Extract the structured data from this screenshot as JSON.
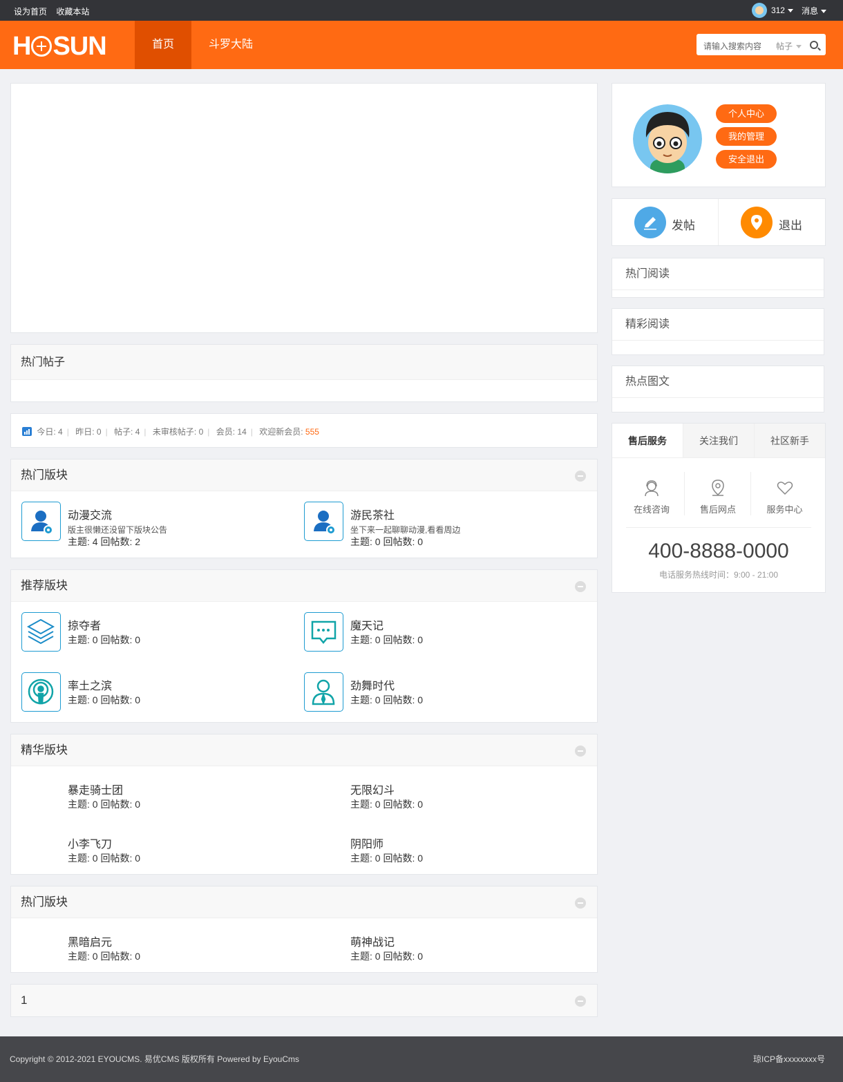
{
  "topbar": {
    "set_home": "设为首页",
    "bookmark": "收藏本站",
    "count": "312",
    "messages": "消息"
  },
  "header": {
    "logo_left": "H",
    "logo_right": "SUN",
    "nav": [
      "首页",
      "斗罗大陆"
    ],
    "search_placeholder": "请输入搜索内容",
    "search_type": "帖子"
  },
  "main": {
    "hot_posts_title": "热门帖子",
    "stats": {
      "today_label": "今日:",
      "today": "4",
      "yesterday_label": "昨日:",
      "yesterday": "0",
      "posts_label": "帖子:",
      "posts": "4",
      "unreviewed_label": "未审核帖子:",
      "unreviewed": "0",
      "members_label": "会员:",
      "members": "14",
      "welcome_label": "欢迎新会员:",
      "welcome": "555"
    },
    "sections": [
      {
        "title": "热门版块",
        "forums": [
          {
            "name": "动漫交流",
            "desc": "版主很懒还没留下版块公告",
            "stat": "主题: 4 回帖数: 2"
          },
          {
            "name": "游民茶社",
            "desc": "坐下来一起聊聊动漫,看看周边",
            "stat": "主题: 0 回帖数: 0"
          }
        ]
      },
      {
        "title": "推荐版块",
        "forums": [
          {
            "name": "掠夺者",
            "stat": "主题: 0 回帖数: 0"
          },
          {
            "name": "魔天记",
            "stat": "主题: 0 回帖数: 0"
          },
          {
            "name": "率土之滨",
            "stat": "主题: 0 回帖数: 0"
          },
          {
            "name": "劲舞时代",
            "stat": "主题: 0 回帖数: 0"
          }
        ]
      },
      {
        "title": "精华版块",
        "forums": [
          {
            "name": "暴走骑士团",
            "stat": "主题: 0 回帖数: 0"
          },
          {
            "name": "无限幻斗",
            "stat": "主题: 0 回帖数: 0"
          },
          {
            "name": "小李飞刀",
            "stat": "主题: 0 回帖数: 0"
          },
          {
            "name": "阴阳师",
            "stat": "主题: 0 回帖数: 0"
          }
        ]
      },
      {
        "title": "热门版块",
        "forums": [
          {
            "name": "黑暗启元",
            "stat": "主题: 0 回帖数: 0"
          },
          {
            "name": "萌神战记",
            "stat": "主题: 0 回帖数: 0"
          }
        ]
      },
      {
        "title": "1",
        "forums": []
      }
    ]
  },
  "sidebar": {
    "user_buttons": [
      "个人中心",
      "我的管理",
      "安全退出"
    ],
    "actions": [
      "发帖",
      "退出"
    ],
    "lists": [
      "热门阅读",
      "精彩阅读",
      "热点图文"
    ],
    "tabs": [
      "售后服务",
      "关注我们",
      "社区新手"
    ],
    "services": [
      "在线咨询",
      "售后网点",
      "服务中心"
    ],
    "phone": "400-8888-0000",
    "hours": "电话服务热线时间：9:00 - 21:00"
  },
  "footer": {
    "copyright": "Copyright © 2012-2021 EYOUCMS. 易优CMS 版权所有 Powered by EyouCms",
    "icp": "琼ICP备xxxxxxxx号"
  },
  "colors": {
    "brand": "#ff6a13",
    "nav_active": "#e04f00",
    "topbar": "#333438",
    "icon_blue": "#1d9bd1",
    "icon_teal": "#11a4a8"
  }
}
